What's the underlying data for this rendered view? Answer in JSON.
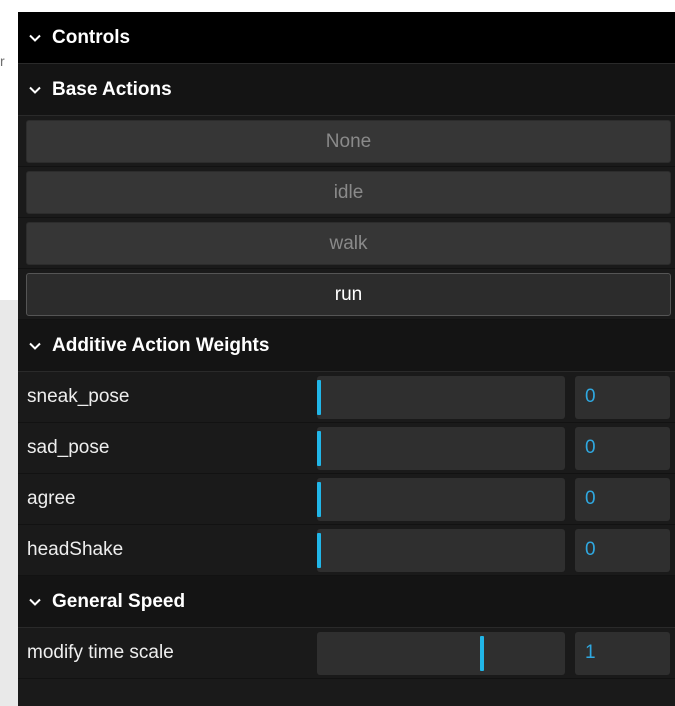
{
  "root_folder": {
    "title": "Controls"
  },
  "backdrop_glyph": "r",
  "base_actions": {
    "title": "Base Actions",
    "buttons": [
      {
        "label": "None",
        "active": false
      },
      {
        "label": "idle",
        "active": false
      },
      {
        "label": "walk",
        "active": false
      },
      {
        "label": "run",
        "active": true
      }
    ]
  },
  "additive_weights": {
    "title": "Additive Action Weights",
    "controls": [
      {
        "label": "sneak_pose",
        "value": "0",
        "fraction": 0.0
      },
      {
        "label": "sad_pose",
        "value": "0",
        "fraction": 0.0
      },
      {
        "label": "agree",
        "value": "0",
        "fraction": 0.0
      },
      {
        "label": "headShake",
        "value": "0",
        "fraction": 0.0
      }
    ]
  },
  "general_speed": {
    "title": "General Speed",
    "controls": [
      {
        "label": "modify time scale",
        "value": "1",
        "fraction": 0.667
      }
    ]
  },
  "colors": {
    "accent": "#21b6e8",
    "panel_bg": "#1a1a1a",
    "title_bg": "#000000"
  }
}
